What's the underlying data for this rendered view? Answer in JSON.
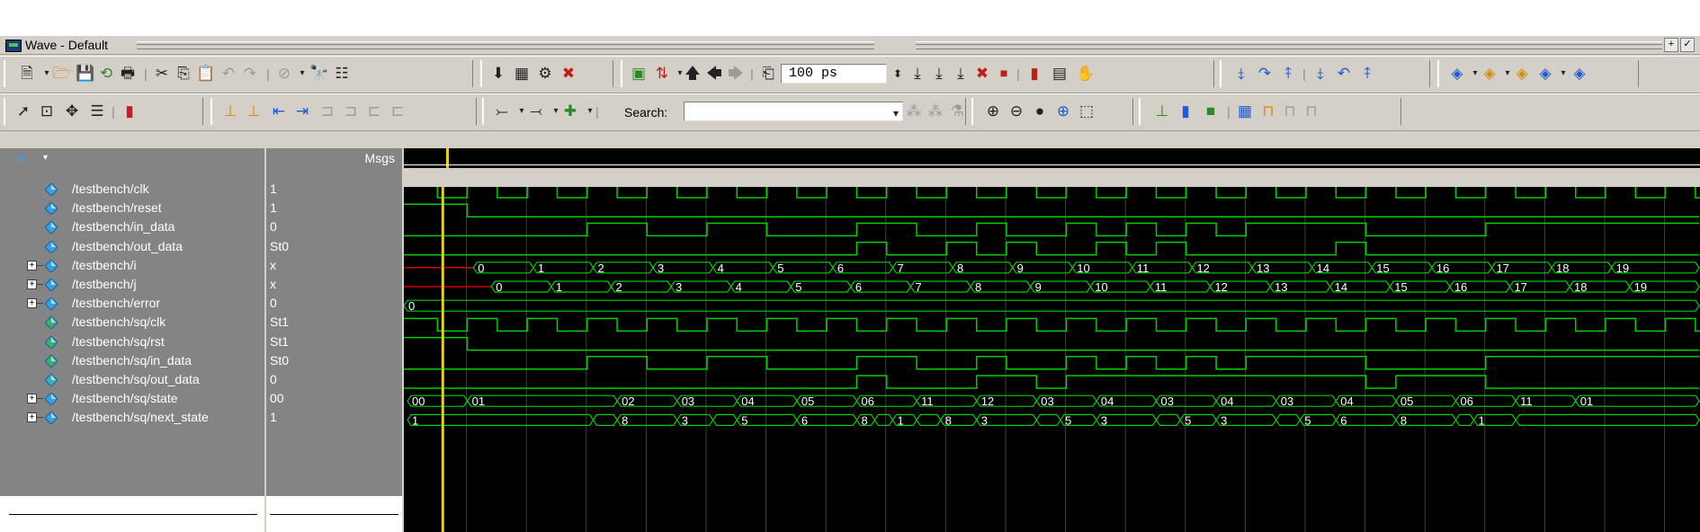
{
  "window": {
    "title": "Wave - Default",
    "controls": [
      "+",
      "✓"
    ]
  },
  "toolbar1": {
    "zoom_value": "100 ps",
    "icons": [
      "new-icon",
      "open-icon",
      "save-icon",
      "reload-icon",
      "print-icon",
      "cut-icon",
      "copy-icon",
      "paste-icon",
      "undo-icon",
      "redo-icon",
      "break-icon",
      "find-icon",
      "format-icon",
      "compile-icon",
      "compile-all-icon",
      "simulate-icon",
      "break-sim-icon",
      "layout-icon",
      "zoom-in-signal-icon",
      "up-icon",
      "back-icon",
      "forward-icon",
      "run-length-icon",
      "run-icon",
      "continue-icon",
      "run-all-icon",
      "stop-icon",
      "break-red-icon",
      "perf-icon",
      "mem-icon",
      "hand-icon",
      "step-icon",
      "step-over-icon",
      "step-out-icon",
      "step-into-icon",
      "step-back-icon",
      "step-back2-icon",
      "layout1-icon",
      "layout2-icon",
      "layout3-icon",
      "layout4-icon",
      "layout5-icon"
    ]
  },
  "toolbar2": {
    "search_label": "Search:",
    "search_value": ""
  },
  "headers": {
    "msgs": "Msgs"
  },
  "signals": [
    {
      "name": "/testbench/clk",
      "value": "1",
      "expandable": false,
      "color": "#3aa0e0"
    },
    {
      "name": "/testbench/reset",
      "value": "1",
      "expandable": false,
      "color": "#3aa0e0"
    },
    {
      "name": "/testbench/in_data",
      "value": "0",
      "expandable": false,
      "color": "#3aa0e0"
    },
    {
      "name": "/testbench/out_data",
      "value": "St0",
      "expandable": false,
      "color": "#3aa0e0"
    },
    {
      "name": "/testbench/i",
      "value": "x",
      "expandable": true,
      "color": "#3aa0e0"
    },
    {
      "name": "/testbench/j",
      "value": "x",
      "expandable": true,
      "color": "#3aa0e0"
    },
    {
      "name": "/testbench/error",
      "value": "0",
      "expandable": true,
      "color": "#3aa0e0"
    },
    {
      "name": "/testbench/sq/clk",
      "value": "St1",
      "expandable": false,
      "color": "#3ab070"
    },
    {
      "name": "/testbench/sq/rst",
      "value": "St1",
      "expandable": false,
      "color": "#3ab070"
    },
    {
      "name": "/testbench/sq/in_data",
      "value": "St0",
      "expandable": false,
      "color": "#3ab070"
    },
    {
      "name": "/testbench/sq/out_data",
      "value": "0",
      "expandable": false,
      "color": "#3ab0b0"
    },
    {
      "name": "/testbench/sq/state",
      "value": "00",
      "expandable": true,
      "color": "#3aa0e0"
    },
    {
      "name": "/testbench/sq/next_state",
      "value": "1",
      "expandable": true,
      "color": "#3aa0e0"
    }
  ],
  "waves": {
    "i_labels": [
      "0",
      "1",
      "2",
      "3",
      "4",
      "5",
      "6",
      "7",
      "8",
      "9",
      "10",
      "11",
      "12",
      "13",
      "14",
      "15",
      "16",
      "17",
      "18",
      "19"
    ],
    "j_labels": [
      "0",
      "1",
      "2",
      "3",
      "4",
      "5",
      "6",
      "7",
      "8",
      "9",
      "10",
      "11",
      "12",
      "13",
      "14",
      "15",
      "16",
      "17",
      "18",
      "19"
    ],
    "error_label": "0",
    "state_labels": [
      "00",
      "01",
      "02",
      "03",
      "04",
      "05",
      "06",
      "11",
      "12",
      "03",
      "04",
      "03",
      "04",
      "03",
      "04",
      "05",
      "06",
      "11",
      "01"
    ],
    "next_labels": [
      "1",
      "8",
      "3",
      "5",
      "6",
      "8",
      "1",
      "8",
      "3",
      "5",
      "3",
      "5",
      "3",
      "5",
      "6",
      "8",
      "1"
    ]
  },
  "colors": {
    "wave": "#00d000",
    "cursor": "#f0d000",
    "undefined": "#d00000",
    "grid": "#404040"
  }
}
